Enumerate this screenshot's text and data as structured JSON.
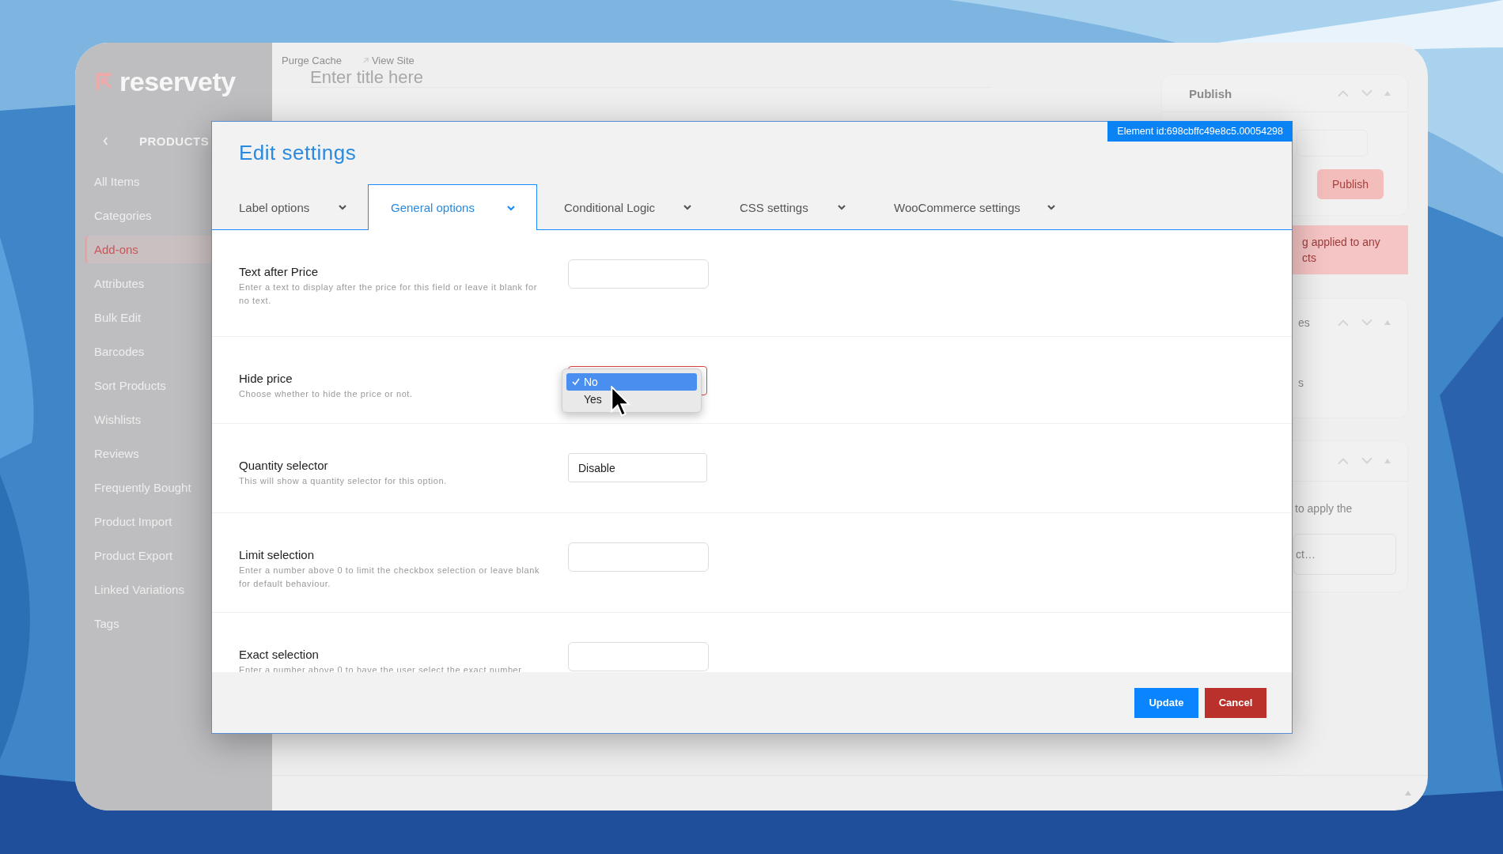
{
  "app": {
    "logo": "reservety",
    "toolbar": [
      {
        "label": "Purge Cache",
        "kind": "plain"
      },
      {
        "label": "View Site",
        "kind": "external"
      }
    ],
    "title_placeholder": "Enter title here"
  },
  "sidebar": {
    "section": "PRODUCTS",
    "items": [
      {
        "label": "All Items",
        "selected": false
      },
      {
        "label": "Categories",
        "selected": false
      },
      {
        "label": "Add-ons",
        "selected": true
      },
      {
        "label": "Attributes",
        "selected": false
      },
      {
        "label": "Bulk Edit",
        "selected": false
      },
      {
        "label": "Barcodes",
        "selected": false
      },
      {
        "label": "Sort Products",
        "selected": false
      },
      {
        "label": "Wishlists",
        "selected": false
      },
      {
        "label": "Reviews",
        "selected": false
      },
      {
        "label": "Frequently Bought",
        "selected": false
      },
      {
        "label": "Product Import",
        "selected": false
      },
      {
        "label": "Product Export",
        "selected": false
      },
      {
        "label": "Linked Variations",
        "selected": false
      },
      {
        "label": "Tags",
        "selected": false
      }
    ]
  },
  "right_panel": {
    "publish_title": "Publish",
    "publish_button": "Publish",
    "notice": [
      "g applied to any",
      "cts"
    ],
    "box2": [
      "es",
      "s"
    ],
    "box3_text": "to apply the",
    "box3_placeholder": "ct…"
  },
  "modal": {
    "title": "Edit settings",
    "element_id": "Element id:698cbffc49e8c5.00054298",
    "tabs": [
      {
        "label": "Label options",
        "selected": false
      },
      {
        "label": "General options",
        "selected": true
      },
      {
        "label": "Conditional Logic",
        "selected": false
      },
      {
        "label": "CSS settings",
        "selected": false
      },
      {
        "label": "WooCommerce settings",
        "selected": false
      }
    ],
    "fields": [
      {
        "kind": "text",
        "label": "Text after Price",
        "description": "Enter a text to display after the price for this field or leave it blank for no text."
      },
      {
        "kind": "select",
        "label": "Hide price",
        "description": "Choose whether to hide the price or not.",
        "open": true,
        "options": [
          {
            "label": "No",
            "selected": true
          },
          {
            "label": "Yes",
            "selected": false
          }
        ]
      },
      {
        "kind": "select",
        "label": "Quantity selector",
        "description": "This will show a quantity selector for this option.",
        "value": "Disable",
        "open": false
      },
      {
        "kind": "text",
        "label": "Limit selection",
        "description": "Enter a number above 0 to limit the checkbox selection or leave blank for default behaviour."
      },
      {
        "kind": "text",
        "label": "Exact selection",
        "description": "Enter a number above 0 to have the user select the exact number"
      }
    ],
    "buttons": [
      {
        "kind": "primary",
        "label": "Update"
      },
      {
        "kind": "danger",
        "label": "Cancel"
      }
    ]
  }
}
